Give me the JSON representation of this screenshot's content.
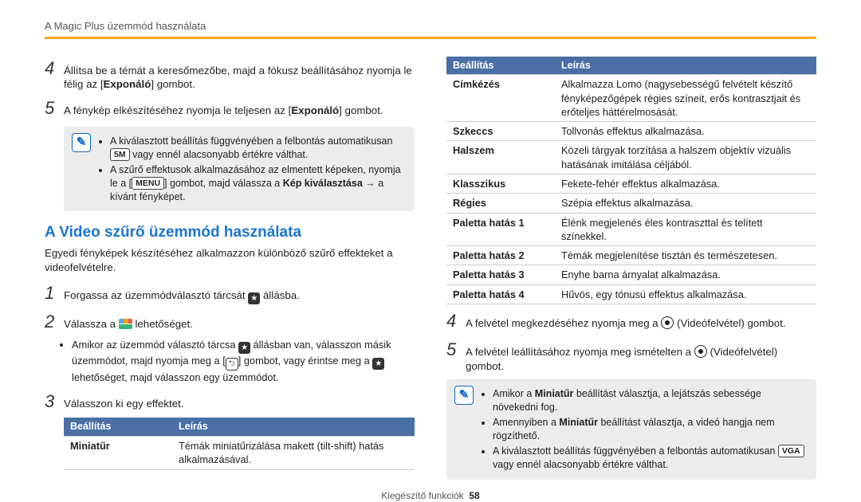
{
  "header": "A Magic Plus üzemmód használata",
  "left": {
    "step4": {
      "num": "4",
      "text_a": "Állítsa be a témát a keresőmezőbe, majd a fókusz beállításához nyomja le félig az [",
      "bold1": "Exponáló",
      "text_b": "] gombot."
    },
    "step5": {
      "num": "5",
      "text_a": "A fénykép elkészítéséhez nyomja le teljesen az [",
      "bold1": "Exponáló",
      "text_b": "] gombot."
    },
    "note1": {
      "li1a": "A kiválasztott beállítás függvényében a felbontás automatikusan ",
      "li1_icon": "5M",
      "li1b": " vagy ennél alacsonyabb értékre válthat.",
      "li2a": "A szűrő effektusok alkalmazásához az elmentett képeken, nyomja le a [",
      "li2_icon": "MENU",
      "li2b": "] gombot, majd válassza a ",
      "li2_bold": "Kép kiválasztása",
      "li2c": " → a kívánt fényképet."
    },
    "sectionTitle": "A Video szűrő üzemmód használata",
    "sectionSub": "Egyedi fényképek készítéséhez alkalmazzon különböző szűrő effekteket a videofelvételre.",
    "s1": {
      "num": "1",
      "text_a": "Forgassa az üzemmódválasztó tárcsát ",
      "text_b": " állásba."
    },
    "s2": {
      "num": "2",
      "text_a": "Válassza a ",
      "text_b": " lehetőséget."
    },
    "s2sub": {
      "a": "Amikor az üzemmód választó tárcsa ",
      "b": " állásban van, válasszon másik üzemmódot, majd nyomja meg a [",
      "c": "] gombot, vagy érintse meg a ",
      "d": " lehetőséget, majd válasszon egy üzemmódot."
    },
    "s3": {
      "num": "3",
      "text": "Válasszon ki egy effektet."
    },
    "table": {
      "h1": "Beállítás",
      "h2": "Leírás",
      "r1c1": "Miniatűr",
      "r1c2": "Témák miniatűrizálása makett (tilt-shift) hatás alkalmazásával."
    }
  },
  "right": {
    "table": {
      "h1": "Beállítás",
      "h2": "Leírás",
      "rows": [
        {
          "c1": "Címkézés",
          "c2": "Alkalmazza Lomo (nagysebességű felvételt készítő fényképezőgépek régies színeit, erős kontrasztjait és erőteljes háttérelmosását."
        },
        {
          "c1": "Szkeccs",
          "c2": "Tollvonás effektus alkalmazása."
        },
        {
          "c1": "Halszem",
          "c2": "Közeli tárgyak torzítása a halszem objektív vizuális hatásának imitálása céljából."
        },
        {
          "c1": "Klasszikus",
          "c2": "Fekete-fehér effektus alkalmazása."
        },
        {
          "c1": "Régies",
          "c2": "Szépia effektus alkalmazása."
        },
        {
          "c1": "Paletta hatás 1",
          "c2": "Élénk megjelenés éles kontraszttal és telített színekkel."
        },
        {
          "c1": "Paletta hatás 2",
          "c2": "Témák megjelenítése tisztán és természetesen."
        },
        {
          "c1": "Paletta hatás 3",
          "c2": "Enyhe barna árnyalat alkalmazása."
        },
        {
          "c1": "Paletta hatás 4",
          "c2": "Hűvös, egy tónusú effektus alkalmazása."
        }
      ]
    },
    "step4": {
      "num": "4",
      "text_a": "A felvétel megkezdéséhez nyomja meg a ",
      "text_b": " (Videófelvétel) gombot."
    },
    "step5": {
      "num": "5",
      "text_a": "A felvétel leállításához nyomja meg ismételten a ",
      "text_b": " (Videófelvétel) gombot."
    },
    "note": {
      "li1a": "Amikor a ",
      "li1_bold": "Miniatűr",
      "li1b": " beállítást választja, a lejátszás sebessége növekedni fog.",
      "li2a": "Amennyiben a ",
      "li2_bold": "Miniatűr",
      "li2b": " beállítást választja, a videó hangja nem rögzíthető.",
      "li3a": "A kiválasztott beállítás függvényében a felbontás automatikusan ",
      "li3_icon": "VGA",
      "li3b": " vagy ennél alacsonyabb értékre válthat."
    }
  },
  "footer": {
    "label": "Kiegészítő funkciók",
    "page": "58"
  },
  "chart_data": {
    "type": "table",
    "title": "Video szűrő effektek",
    "columns": [
      "Beállítás",
      "Leírás"
    ],
    "rows": [
      [
        "Miniatűr",
        "Témák miniatűrizálása makett (tilt-shift) hatás alkalmazásával."
      ],
      [
        "Címkézés",
        "Alkalmazza Lomo (nagysebességű felvételt készítő fényképezőgépek régies színeit, erős kontrasztjait és erőteljes háttérelmosását."
      ],
      [
        "Szkeccs",
        "Tollvonás effektus alkalmazása."
      ],
      [
        "Halszem",
        "Közeli tárgyak torzítása a halszem objektív vizuális hatásának imitálása céljából."
      ],
      [
        "Klasszikus",
        "Fekete-fehér effektus alkalmazása."
      ],
      [
        "Régies",
        "Szépia effektus alkalmazása."
      ],
      [
        "Paletta hatás 1",
        "Élénk megjelenés éles kontraszttal és telített színekkel."
      ],
      [
        "Paletta hatás 2",
        "Témák megjelenítése tisztán és természetesen."
      ],
      [
        "Paletta hatás 3",
        "Enyhe barna árnyalat alkalmazása."
      ],
      [
        "Paletta hatás 4",
        "Hűvös, egy tónusú effektus alkalmazása."
      ]
    ]
  }
}
